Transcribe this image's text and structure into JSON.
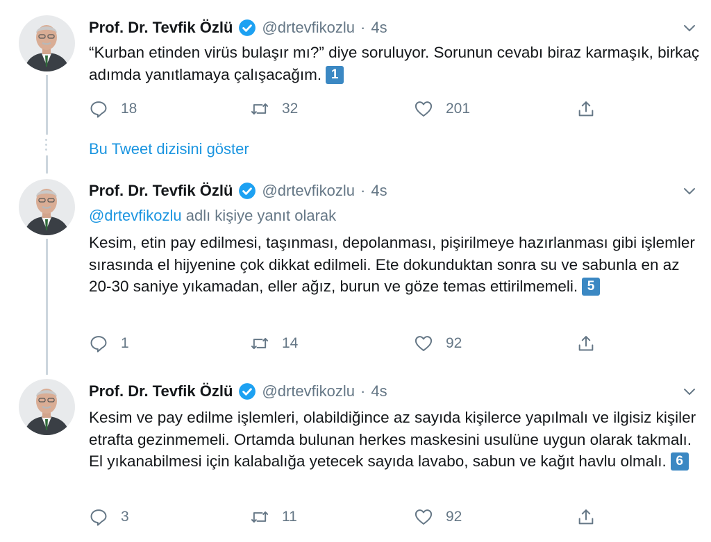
{
  "tweets": [
    {
      "author_name": "Prof. Dr. Tevfik Özlü",
      "handle": "@drtevfikozlu",
      "separator": "·",
      "time": "4s",
      "replying_mention": "",
      "replying_suffix": "",
      "text": "“Kurban etinden virüs bulaşır mı?” diye soruluyor. Sorunun cevabı biraz karmaşık, birkaç adımda yanıtlamaya çalışacağım.",
      "badge": "1",
      "replies": "18",
      "retweets": "32",
      "likes": "201"
    },
    {
      "author_name": "Prof. Dr. Tevfik Özlü",
      "handle": "@drtevfikozlu",
      "separator": "·",
      "time": "4s",
      "replying_mention": "@drtevfikozlu",
      "replying_suffix": " adlı kişiye yanıt olarak",
      "text": "Kesim, etin pay edilmesi, taşınması, depolanması, pişirilmeye hazırlanması gibi işlemler sırasında el hijyenine çok dikkat edilmeli. Ete dokunduktan sonra su ve sabunla en az 20-30 saniye yıkamadan, eller ağız, burun ve göze temas ettirilmemeli.",
      "badge": "5",
      "replies": "1",
      "retweets": "14",
      "likes": "92"
    },
    {
      "author_name": "Prof. Dr. Tevfik Özlü",
      "handle": "@drtevfikozlu",
      "separator": "·",
      "time": "4s",
      "replying_mention": "",
      "replying_suffix": "",
      "text": "Kesim ve pay edilme işlemleri, olabildiğince az sayıda kişilerce yapılmalı ve ilgisiz kişiler etrafta gezinmemeli. Ortamda bulunan herkes maskesini usulüne uygun olarak takmalı. El yıkanabilmesi için kalabalığa yetecek sayıda lavabo, sabun ve kağıt havlu olmalı.",
      "badge": "6",
      "replies": "3",
      "retweets": "11",
      "likes": "92"
    }
  ],
  "show_thread_label": "Bu Tweet dizisini göster",
  "colors": {
    "link": "#1b95e0",
    "muted": "#657786",
    "verified": "#1da1f2",
    "badge": "#3b88c3",
    "thread_line": "#ccd6dd"
  },
  "icons": [
    "verified-badge-icon",
    "chevron-down-icon",
    "reply-icon",
    "retweet-icon",
    "like-icon",
    "share-icon"
  ]
}
